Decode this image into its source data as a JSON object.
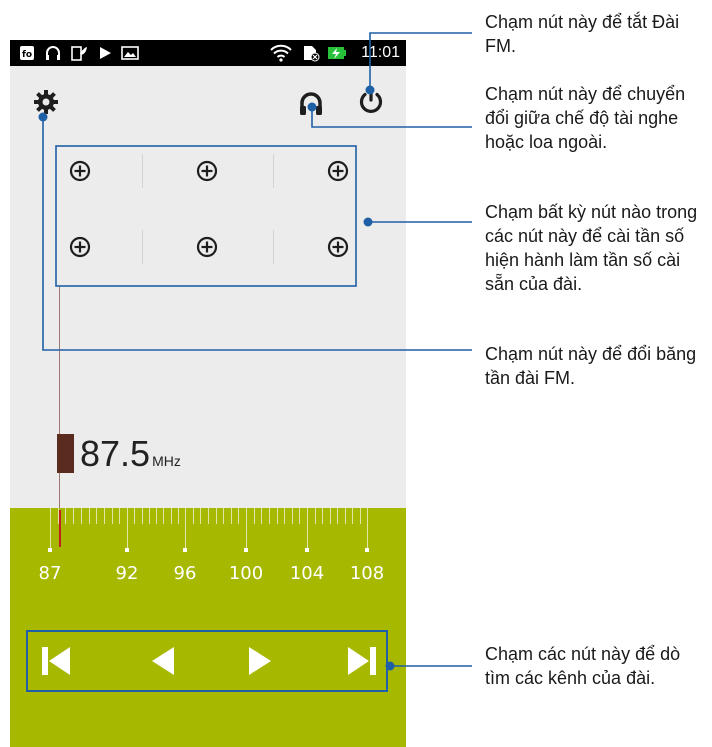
{
  "status_bar": {
    "time": "11:01",
    "icons": [
      "fm-icon",
      "headphone-icon",
      "battery-saver-icon",
      "play-icon",
      "image-icon",
      "wifi-icon",
      "sim-icon",
      "charging-icon"
    ]
  },
  "radio": {
    "frequency": "87.5",
    "unit": "MHz",
    "scale": {
      "min": 87,
      "max": 108,
      "labels": [
        "87",
        "92",
        "96",
        "100",
        "104",
        "108"
      ]
    },
    "presets": [
      "add-preset",
      "add-preset",
      "add-preset",
      "add-preset",
      "add-preset",
      "add-preset"
    ]
  },
  "callouts": {
    "power": "Chạm nút này để tắt Đài FM.",
    "output": "Chạm nút này để chuyển đổi giữa chế độ tài nghe hoặc loa ngoài.",
    "presets": "Chạm bất kỳ nút nào trong các nút này để cài tần số hiện hành làm tần số cài sẵn của đài.",
    "band": "Chạm nút này để đổi băng tần đài FM.",
    "tuning": "Chạm các nút này để dò tìm các kênh của đài."
  },
  "colors": {
    "accent": "#1f5fa6",
    "lower_panel": "#a6b800",
    "screen_bg": "#ececec",
    "tuner_block": "#5a2b1f",
    "needle": "#c02020"
  }
}
